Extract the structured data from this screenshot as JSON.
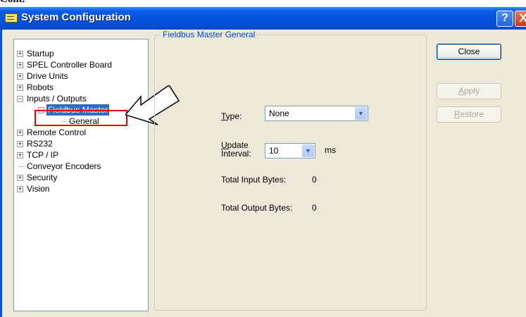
{
  "cut_text": "Cont.",
  "window": {
    "title": "System Configuration",
    "help_glyph": "?",
    "close_glyph": "X"
  },
  "tree": {
    "items": [
      {
        "label": "Startup",
        "expander": "+"
      },
      {
        "label": "SPEL Controller Board",
        "expander": "+"
      },
      {
        "label": "Drive Units",
        "expander": "+"
      },
      {
        "label": "Robots",
        "expander": "+"
      },
      {
        "label": "Inputs / Outputs",
        "expander": "−"
      },
      {
        "label": "Fieldbus Master",
        "expander": "−"
      },
      {
        "label": "General"
      },
      {
        "label": "Remote Control",
        "expander": "+"
      },
      {
        "label": "RS232",
        "expander": "+"
      },
      {
        "label": "TCP / IP",
        "expander": "+"
      },
      {
        "label": "Conveyor Encoders"
      },
      {
        "label": "Security",
        "expander": "+"
      },
      {
        "label": "Vision",
        "expander": "+"
      }
    ]
  },
  "panel": {
    "group_title": "Fieldbus Master General",
    "type_label_hot": "T",
    "type_label_rest": "ype:",
    "type_value": "None",
    "interval_label_hot": "U",
    "interval_label_rest1": "pdate",
    "interval_label_line2": "Interval:",
    "interval_value": "10",
    "interval_unit": "ms",
    "input_bytes_label": "Total Input Bytes:",
    "input_bytes_value": "0",
    "output_bytes_label": "Total Output Bytes:",
    "output_bytes_value": "0"
  },
  "buttons": {
    "close": "Close",
    "apply_hot": "A",
    "apply_rest": "pply",
    "restore_hot": "R",
    "restore_rest": "estore"
  },
  "icons": {
    "dropdown": "▼",
    "window_icon": "window-icon",
    "pointer": "arrow-pointer-icon"
  },
  "colors": {
    "titlebar": "#0252DB",
    "selection": "#316AC5",
    "highlight": "#E00000",
    "group_title": "#0046D5"
  }
}
